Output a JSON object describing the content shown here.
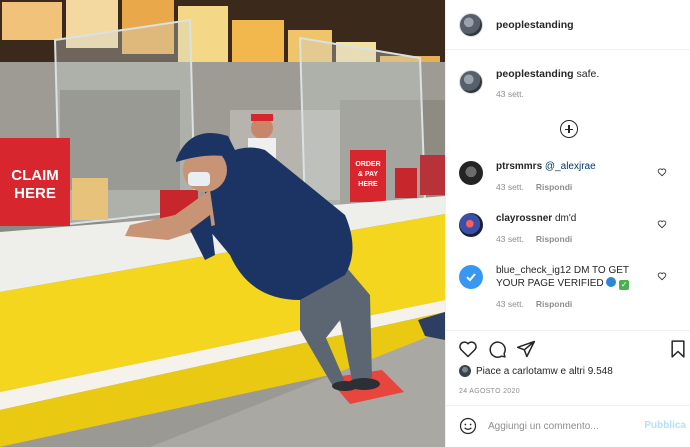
{
  "photo": {
    "signs": {
      "claim_line1": "CLAIM",
      "claim_line2": "HERE",
      "order_line1": "ORDER",
      "order_line2": "& PAY",
      "order_line3": "HERE"
    }
  },
  "header": {
    "username": "peoplestanding",
    "avatar_icon": "profile-avatar"
  },
  "caption": {
    "username": "peoplestanding",
    "text": "safe.",
    "time": "43 sett."
  },
  "load_more_icon": "plus-circle-icon",
  "comments": [
    {
      "username": "ptrsmmrs",
      "mention": "@_alexjrae",
      "text": "",
      "time": "43 sett.",
      "reply": "Rispondi"
    },
    {
      "username": "clayrossner",
      "mention": "",
      "text": "dm'd",
      "time": "43 sett.",
      "reply": "Rispondi"
    },
    {
      "username": "blue_check_ig12",
      "mention": "",
      "text": "DM TO GET YOUR PAGE VERIFIED",
      "emoji_1": "blue-circle",
      "emoji_2": "check-mark",
      "time": "43 sett.",
      "reply": "Rispondi"
    }
  ],
  "actions": {
    "icons": [
      "heart-icon",
      "comment-icon",
      "share-icon",
      "bookmark-icon"
    ],
    "likes_prefix": "Piace a",
    "likes_user": "carlotamw",
    "likes_suffix": "e altri",
    "likes_count": "9.548",
    "date": "24 AGOSTO 2020"
  },
  "comment_box": {
    "placeholder": "Aggiungi un commento...",
    "publish": "Pubblica",
    "emoji_icon": "smile-icon"
  },
  "colors": {
    "link_blue": "#00376b",
    "publish_disabled": "#b2dffc",
    "meta_gray": "#8e8e8e",
    "counter_yellow": "#f4d61e",
    "sign_red": "#d8262f",
    "floor_marker": "#e8453c"
  }
}
